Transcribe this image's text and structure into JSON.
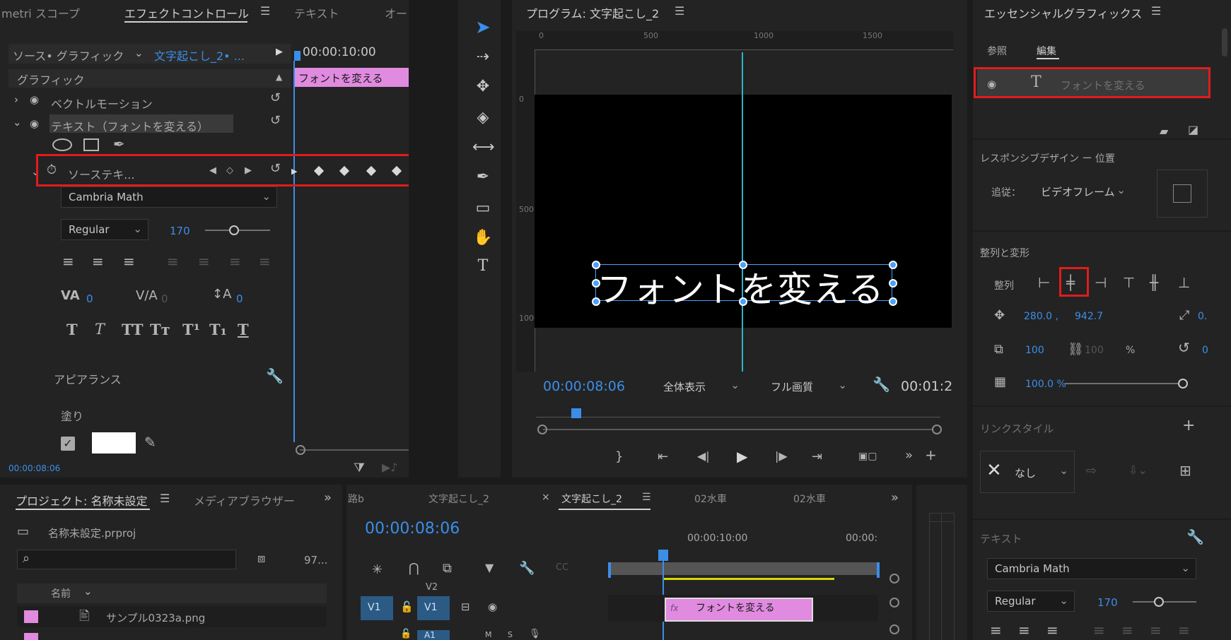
{
  "effect_panel": {
    "tabs": [
      "metri スコープ",
      "エフェクトコントロール",
      "テキスト",
      "オー"
    ],
    "source_label": "ソース• グラフィック",
    "sequence_link": "文字起こし_2• ...",
    "timecode": "00:00:10:00",
    "clip_label": "フォントを変える",
    "section_graphic": "グラフィック",
    "vector_motion": "ベクトルモーション",
    "text_layer": "テキスト（フォントを変える）",
    "source_text": "ソーステキ...",
    "font": "Cambria Math",
    "font_style": "Regular",
    "font_size": "170",
    "tracking_value": "0",
    "kerning_value": "0",
    "baseline_value": "0",
    "appearance": "アピアランス",
    "fill": "塗り",
    "fill_color": "#ffffff",
    "bottom_time": "00:00:08:06"
  },
  "program": {
    "title": "プログラム: 文字起こし_2",
    "ruler": [
      "0",
      "500",
      "1000",
      "1500"
    ],
    "vruler": [
      "0",
      "500",
      "1000"
    ],
    "text": "フォントを変える",
    "timecode": "00:00:08:06",
    "zoom": "全体表示",
    "quality": "フル画質",
    "duration": "00:01:2"
  },
  "essential": {
    "title": "エッセンシャルグラフィックス",
    "tab_browse": "参照",
    "tab_edit": "編集",
    "layer_label": "フォントを変える",
    "responsive": "レスポンシブデザイン ー 位置",
    "follow_label": "追従：",
    "follow_value": "ビデオフレーム",
    "align_section": "整列と変形",
    "align_label": "整列",
    "pos_x": "280.0 ,",
    "pos_y": "942.7",
    "rot_partial": "0.",
    "scale": "100",
    "scale2": "100",
    "percent": "%",
    "rotation": "0",
    "opacity": "100.0 %",
    "link_style": "リンクスタイル",
    "none": "なし",
    "text_section": "テキスト",
    "font": "Cambria Math",
    "font_style": "Regular",
    "font_size": "170"
  },
  "project": {
    "tab_project": "プロジェクト: 名称未設定",
    "tab_media": "メディアブラウザー",
    "file": "名称未設定.prproj",
    "count": "97...",
    "col_name": "名前",
    "item": "サンプル0323a.png",
    "item_color": "#e08ae0"
  },
  "timeline": {
    "tabs": [
      "路b",
      "文字起こし_2",
      "文字起こし_2",
      "02水車",
      "02水車"
    ],
    "timecode": "00:00:08:06",
    "ruler1": "00:00:10:00",
    "ruler2": "00:00:",
    "track_v2": "V2",
    "track_v1": "V1",
    "track_v1b": "V1",
    "track_a1": "A1",
    "clip_label": "フォントを変える",
    "clip_color": "#e08ae0"
  }
}
